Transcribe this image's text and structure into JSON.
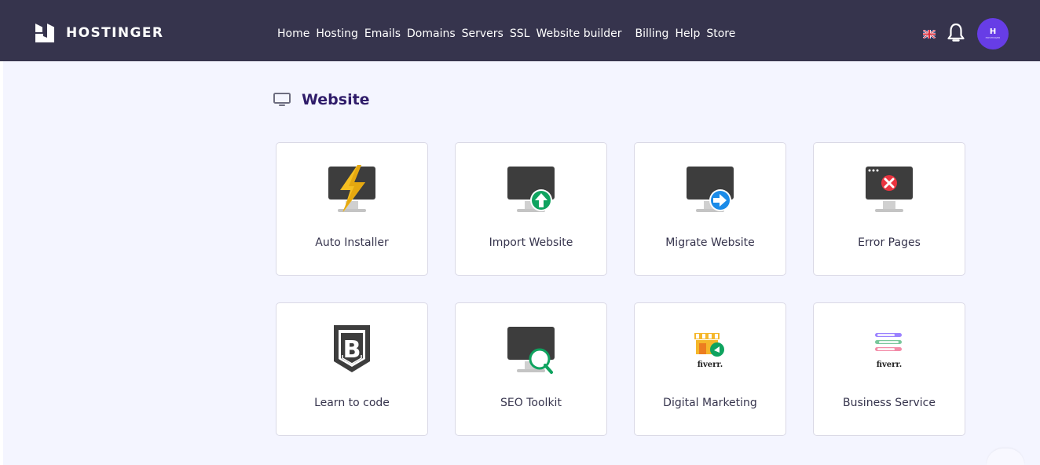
{
  "brand": {
    "name": "HOSTINGER",
    "avatar_mark": "H",
    "avatar_small": "HOSTINGER"
  },
  "nav": {
    "items": [
      "Home",
      "Hosting",
      "Emails",
      "Domains",
      "Servers",
      "SSL",
      "Website builder",
      "Billing",
      "Help",
      "Store"
    ]
  },
  "header_icons": {
    "language": "flag-uk-icon",
    "notifications": "bell-icon",
    "account": "avatar"
  },
  "section": {
    "title": "Website",
    "icon": "monitor-icon"
  },
  "tools": [
    {
      "label": "Auto Installer",
      "icon": "lightning-monitor-icon"
    },
    {
      "label": "Import Website",
      "icon": "upload-monitor-icon"
    },
    {
      "label": "Migrate Website",
      "icon": "migrate-monitor-icon"
    },
    {
      "label": "Error Pages",
      "icon": "error-monitor-icon"
    },
    {
      "label": "Learn to code",
      "icon": "code-shield-icon"
    },
    {
      "label": "SEO Toolkit",
      "icon": "seo-monitor-icon"
    },
    {
      "label": "Digital Marketing",
      "icon": "fiverr-marketing-icon"
    },
    {
      "label": "Business Service",
      "icon": "fiverr-business-icon"
    }
  ],
  "fiverr_label": "fiverr.",
  "colors": {
    "header": "#36344d",
    "accent": "#673de6",
    "background": "#f4f5ff",
    "card_border": "#dad9e6"
  }
}
